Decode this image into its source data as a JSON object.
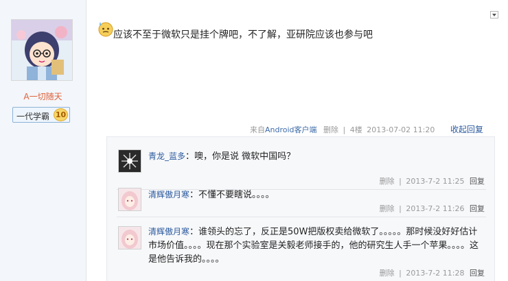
{
  "user": {
    "name": "A一切随天",
    "rank_label": "一代学霸",
    "rank_level": "10"
  },
  "post": {
    "content": "应该不至于微软只是挂个牌吧，不了解，亚研院应该也参与吧",
    "source_prefix": "来自",
    "client": "Android客户端",
    "delete_label": "删除",
    "floor": "4楼",
    "timestamp": "2013-07-02 11:20",
    "collapse_label": "收起回复"
  },
  "replies": [
    {
      "author": "青龙_蓝多",
      "content": "噢，你是说 微软中国吗？",
      "delete_label": "删除",
      "timestamp": "2013-7-2 11:25",
      "reply_label": "回复",
      "avatar_color": "#2a2a2a"
    },
    {
      "author": "清辉傲月寒",
      "content": "不懂不要瞎说。。。。",
      "delete_label": "删除",
      "timestamp": "2013-7-2 11:26",
      "reply_label": "回复",
      "avatar_color": "#f2c9cf"
    },
    {
      "author": "清辉傲月寒",
      "content": "谁领头的忘了，反正是50W把版权卖给微软了。。。。。那时候没好好估计市场价值。。。。现在那个实验室是关毅老师接手的，他的研究生人手一个苹果。。。。这是他告诉我的。。。。",
      "delete_label": "删除",
      "timestamp": "2013-7-2 11:28",
      "reply_label": "回复",
      "avatar_color": "#f2c9cf"
    }
  ],
  "colors": {
    "link": "#2b5a9e",
    "username": "#e0603a",
    "sidebar_bg": "#f3f6fa",
    "reply_panel_bg": "#f7f8fa"
  },
  "icons": {
    "post_emoji": "sweat-emoji-icon",
    "menu": "dropdown-arrow-icon"
  }
}
